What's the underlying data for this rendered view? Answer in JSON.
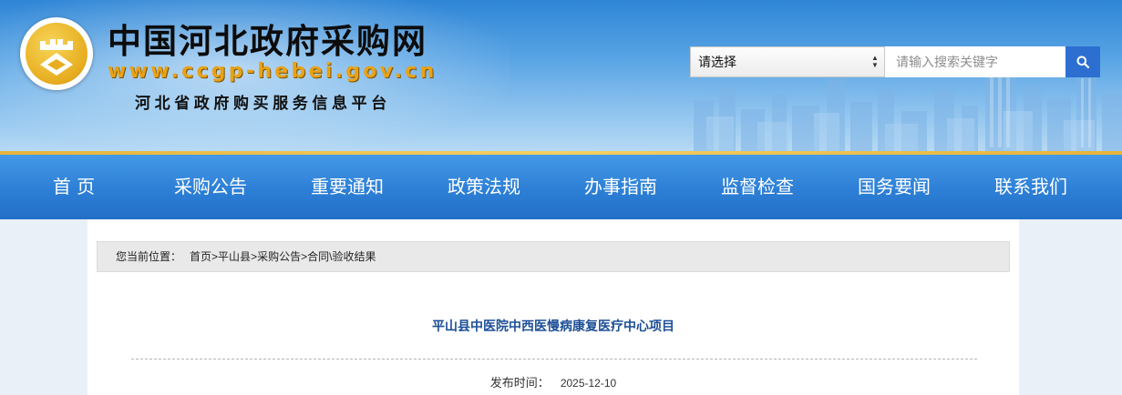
{
  "header": {
    "title": "中国河北政府采购网",
    "url": "www.ccgp-hebei.gov.cn",
    "subtitle": "河北省政府购买服务信息平台"
  },
  "search": {
    "select_value": "请选择",
    "input_placeholder": "请输入搜索关键字",
    "input_value": ""
  },
  "nav": {
    "items": [
      {
        "label": "首 页"
      },
      {
        "label": "采购公告"
      },
      {
        "label": "重要通知"
      },
      {
        "label": "政策法规"
      },
      {
        "label": "办事指南"
      },
      {
        "label": "监督检查"
      },
      {
        "label": "国务要闻"
      },
      {
        "label": "联系我们"
      }
    ]
  },
  "breadcrumb": {
    "label": "您当前位置：",
    "items": [
      "首页",
      "平山县",
      "采购公告",
      "合同\\验收结果"
    ],
    "separator": ">"
  },
  "article": {
    "title": "平山县中医院中西医慢病康复医疗中心项目",
    "publish_label": "发布时间：",
    "publish_date": "2025-12-10"
  },
  "icons": {
    "logo": "government-procurement-emblem",
    "search": "search-icon",
    "select": "select-arrows-icon"
  },
  "colors": {
    "nav": "#2d7fd6",
    "gold": "#e9a215",
    "title_blue": "#1d4f96",
    "search_button": "#2c6fd1"
  }
}
